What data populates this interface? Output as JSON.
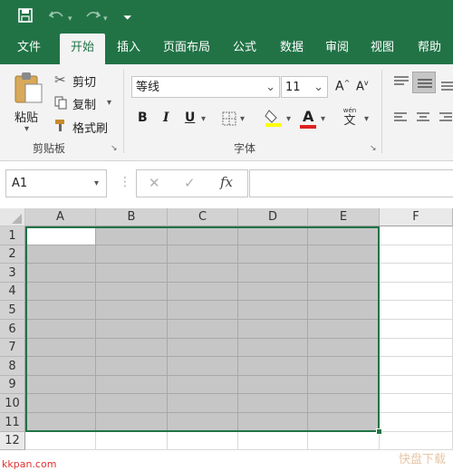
{
  "qat": {
    "save_icon": "save-icon",
    "undo_icon": "undo-icon",
    "redo_icon": "redo-icon",
    "customize_icon": "customize-qat-icon"
  },
  "tabs": [
    "文件",
    "开始",
    "插入",
    "页面布局",
    "公式",
    "数据",
    "审阅",
    "视图",
    "帮助"
  ],
  "active_tab": "开始",
  "clipboard": {
    "paste": "粘贴",
    "cut": "剪切",
    "copy": "复制",
    "format_painter": "格式刷",
    "group_label": "剪贴板"
  },
  "font": {
    "name": "等线",
    "size": "11",
    "grow": "A",
    "shrink": "A",
    "bold": "B",
    "italic": "I",
    "underline": "U",
    "font_color_glyph": "A",
    "phonetic_top": "wén",
    "phonetic_bottom": "文",
    "group_label": "字体"
  },
  "formula_bar": {
    "name_box": "A1",
    "fx": "fx",
    "cancel": "✕",
    "enter": "✓",
    "value": ""
  },
  "columns": [
    "A",
    "B",
    "C",
    "D",
    "E",
    "F"
  ],
  "rows": [
    "1",
    "2",
    "3",
    "4",
    "5",
    "6",
    "7",
    "8",
    "9",
    "10",
    "11",
    "12"
  ],
  "selection": {
    "range": "A1:E11",
    "active_cell": "A1"
  },
  "accent_color": "#217346",
  "watermark": {
    "left": "kkpan.com",
    "right": "快盘下载"
  }
}
